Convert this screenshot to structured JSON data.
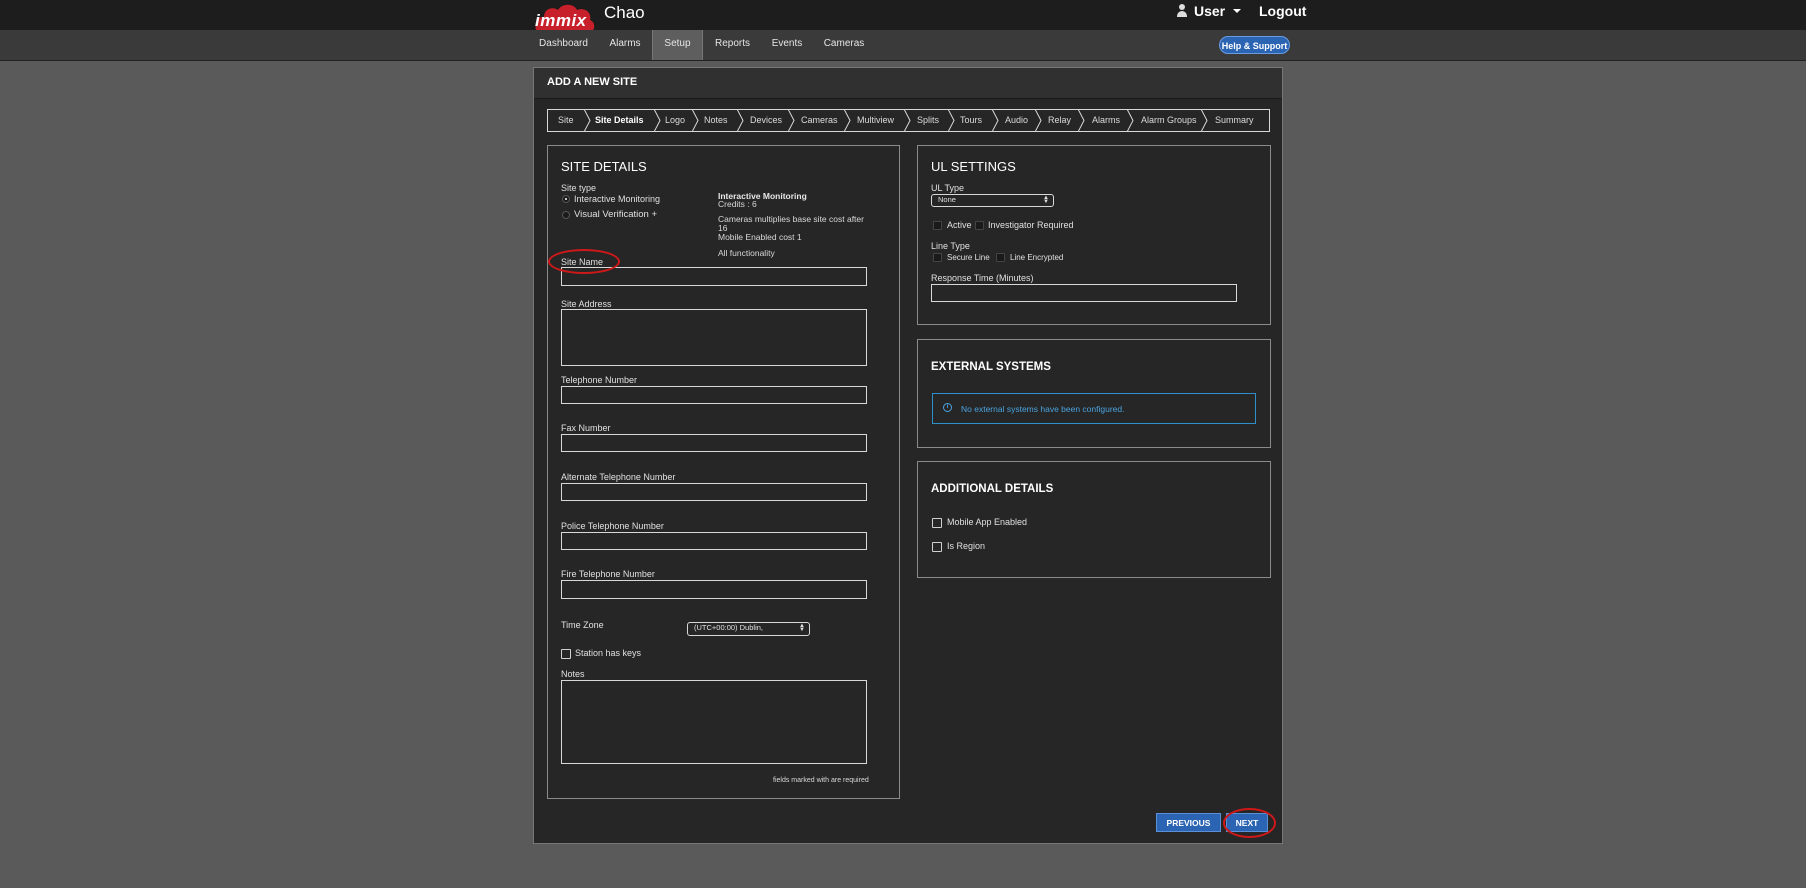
{
  "header": {
    "logo_text": "immix",
    "site_title": "Chao",
    "user_label": "User",
    "logout_label": "Logout"
  },
  "nav": {
    "items": [
      "Dashboard",
      "Alarms",
      "Setup",
      "Reports",
      "Events",
      "Cameras"
    ],
    "active": "Setup",
    "help_label": "Help & Support"
  },
  "page": {
    "title": "ADD A NEW SITE"
  },
  "wizard": {
    "steps": [
      "Site",
      "Site Details",
      "Logo",
      "Notes",
      "Devices",
      "Cameras",
      "Multiview",
      "Splits",
      "Tours",
      "Audio",
      "Relay",
      "Alarms",
      "Alarm Groups",
      "Summary"
    ],
    "active": "Site Details"
  },
  "site_details": {
    "title": "SITE DETAILS",
    "site_type_label": "Site type",
    "site_type_options": [
      "Interactive Monitoring",
      "Visual Verification +"
    ],
    "site_type_selected": "Interactive Monitoring",
    "info_title": "Interactive Monitoring",
    "info_credits": "Credits : 6",
    "info_cameras": "Cameras multiplies base site cost after",
    "info_cameras_count": "16",
    "info_mobile": "Mobile Enabled cost 1",
    "info_functionality": "All functionality",
    "site_name_label": "Site Name",
    "site_name_value": "",
    "site_address_label": "Site Address",
    "telephone_label": "Telephone Number",
    "fax_label": "Fax Number",
    "alt_telephone_label": "Alternate Telephone Number",
    "police_telephone_label": "Police Telephone Number",
    "fire_telephone_label": "Fire Telephone Number",
    "time_zone_label": "Time Zone",
    "time_zone_value": "(UTC+00:00) Dublin,",
    "station_keys_label": "Station has keys",
    "station_keys_checked": false,
    "notes_label": "Notes",
    "required_note_prefix": "fields marked with",
    "required_note_suffix": "are required"
  },
  "ul_settings": {
    "title": "UL SETTINGS",
    "ul_type_label": "UL Type",
    "ul_type_value": "None",
    "active_label": "Active",
    "investigator_label": "Investigator Required",
    "line_type_label": "Line Type",
    "secure_line_label": "Secure Line",
    "line_encrypted_label": "Line Encrypted",
    "response_time_label": "Response Time (Minutes)",
    "response_time_value": ""
  },
  "external_systems": {
    "title": "EXTERNAL SYSTEMS",
    "notice": "No external systems have been configured.",
    "notice_icon": "info-icon"
  },
  "additional_details": {
    "title": "ADDITIONAL DETAILS",
    "mobile_app_label": "Mobile App Enabled",
    "is_region_label": "Is Region",
    "mobile_app_checked": false,
    "is_region_checked": false
  },
  "actions": {
    "previous_label": "PREVIOUS",
    "next_label": "NEXT"
  },
  "colors": {
    "accent_blue": "#2b64b3",
    "annotation_red": "#d01818",
    "info_blue": "#4aa3df"
  }
}
